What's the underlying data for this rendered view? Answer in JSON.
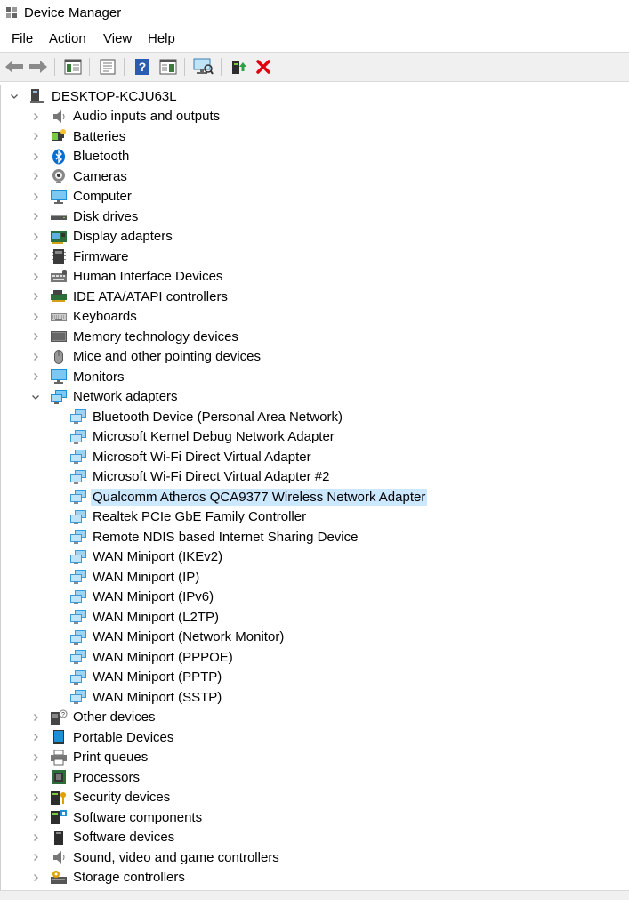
{
  "window": {
    "title": "Device Manager"
  },
  "menu": [
    "File",
    "Action",
    "View",
    "Help"
  ],
  "toolbar": {
    "buttons": [
      "back",
      "forward",
      "show-hide-console-tree",
      "properties",
      "help",
      "action-pane",
      "scan-hardware-changes",
      "update-driver",
      "uninstall-device"
    ]
  },
  "tree": {
    "root": "DESKTOP-KCJU63L",
    "categories_before": [
      {
        "label": "Audio inputs and outputs",
        "icon": "speaker-icon"
      },
      {
        "label": "Batteries",
        "icon": "battery-icon"
      },
      {
        "label": "Bluetooth",
        "icon": "bluetooth-icon"
      },
      {
        "label": "Cameras",
        "icon": "camera-icon"
      },
      {
        "label": "Computer",
        "icon": "computer-icon"
      },
      {
        "label": "Disk drives",
        "icon": "disk-drive-icon"
      },
      {
        "label": "Display adapters",
        "icon": "display-adapter-icon"
      },
      {
        "label": "Firmware",
        "icon": "firmware-icon"
      },
      {
        "label": "Human Interface Devices",
        "icon": "hid-icon"
      },
      {
        "label": "IDE ATA/ATAPI controllers",
        "icon": "ide-controller-icon"
      },
      {
        "label": "Keyboards",
        "icon": "keyboard-icon"
      },
      {
        "label": "Memory technology devices",
        "icon": "memory-icon"
      },
      {
        "label": "Mice and other pointing devices",
        "icon": "mouse-icon"
      },
      {
        "label": "Monitors",
        "icon": "monitor-icon"
      }
    ],
    "expanded": {
      "label": "Network adapters",
      "icon": "network-adapter-icon",
      "children": [
        "Bluetooth Device (Personal Area Network)",
        "Microsoft Kernel Debug Network Adapter",
        "Microsoft Wi-Fi Direct Virtual Adapter",
        "Microsoft Wi-Fi Direct Virtual Adapter #2",
        "Qualcomm Atheros QCA9377 Wireless Network Adapter",
        "Realtek PCIe GbE Family Controller",
        "Remote NDIS based Internet Sharing Device",
        "WAN Miniport (IKEv2)",
        "WAN Miniport (IP)",
        "WAN Miniport (IPv6)",
        "WAN Miniport (L2TP)",
        "WAN Miniport (Network Monitor)",
        "WAN Miniport (PPPOE)",
        "WAN Miniport (PPTP)",
        "WAN Miniport (SSTP)"
      ],
      "selected_child": "Qualcomm Atheros QCA9377 Wireless Network Adapter"
    },
    "categories_after": [
      {
        "label": "Other devices",
        "icon": "other-devices-icon"
      },
      {
        "label": "Portable Devices",
        "icon": "portable-device-icon"
      },
      {
        "label": "Print queues",
        "icon": "printer-icon"
      },
      {
        "label": "Processors",
        "icon": "processor-icon"
      },
      {
        "label": "Security devices",
        "icon": "security-device-icon"
      },
      {
        "label": "Software components",
        "icon": "software-component-icon"
      },
      {
        "label": "Software devices",
        "icon": "software-device-icon"
      },
      {
        "label": "Sound, video and game controllers",
        "icon": "sound-controller-icon"
      },
      {
        "label": "Storage controllers",
        "icon": "storage-controller-icon"
      }
    ]
  },
  "colors": {
    "selection": "#cce8ff",
    "toolbar_bg": "#f0f0f0",
    "uninstall": "#e0000f",
    "help": "#2a5db0"
  }
}
